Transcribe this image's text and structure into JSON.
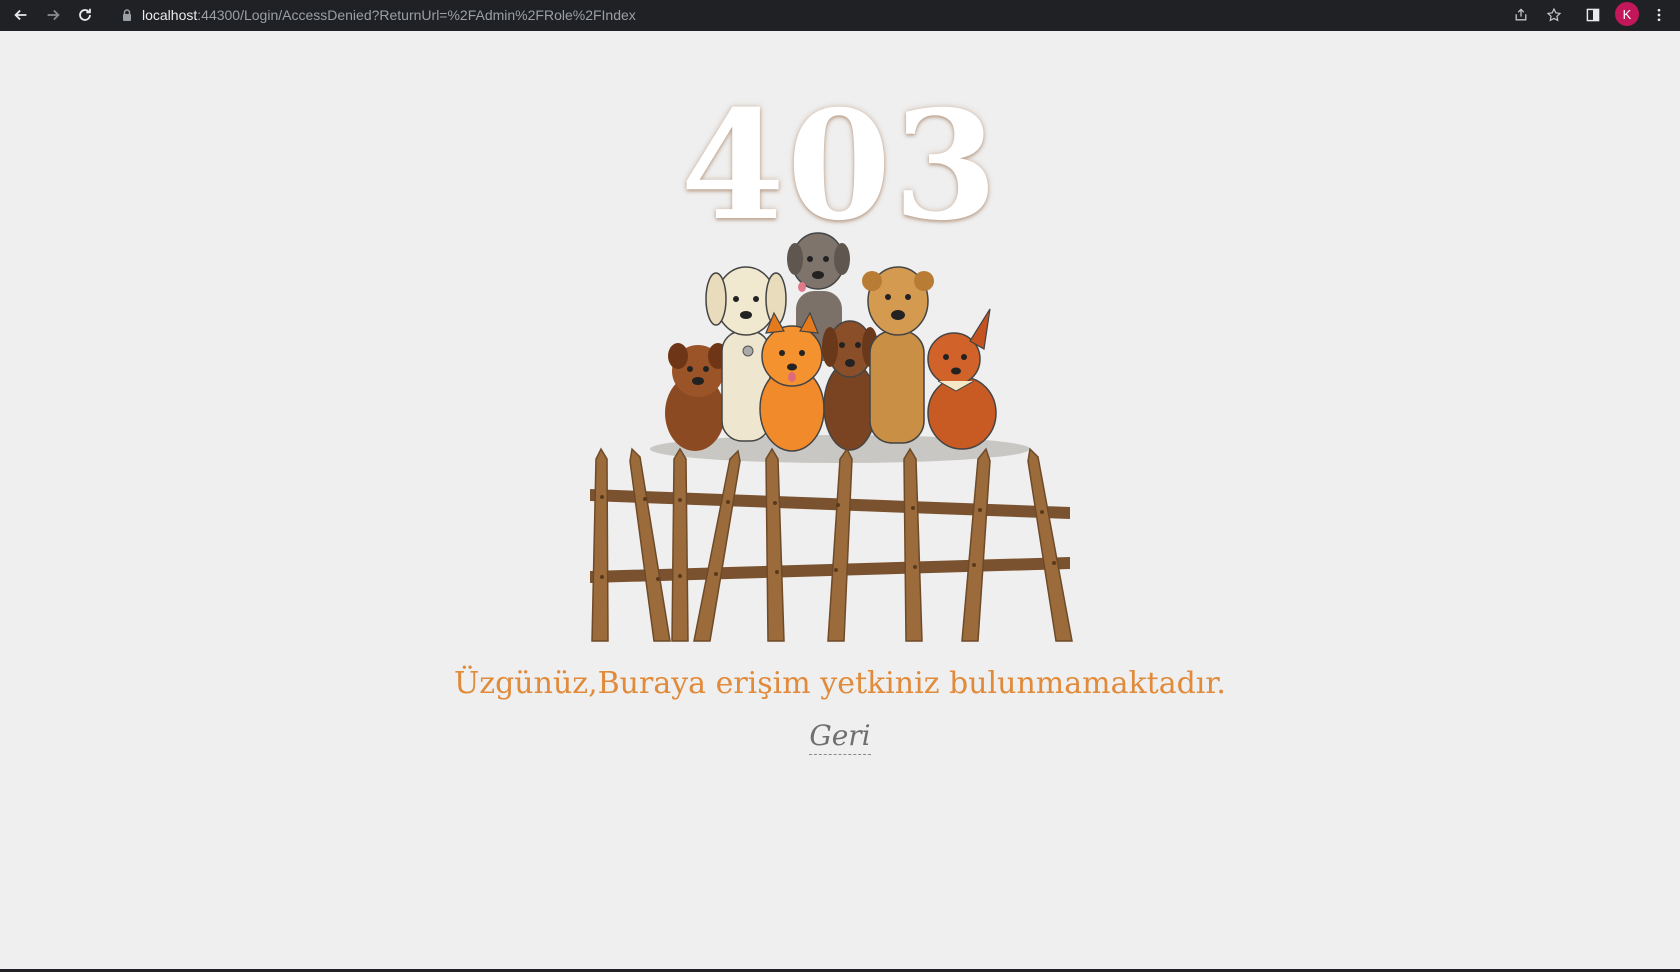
{
  "browser": {
    "url_host": "localhost",
    "url_rest": ":44300/Login/AccessDenied?ReturnUrl=%2FAdmin%2FRole%2FIndex",
    "profile_initial": "K",
    "profile_color": "#c2185b"
  },
  "page": {
    "error_code": "403",
    "message": "Üzgünüz,Buraya erişim yetkiniz bulunmamaktadır.",
    "back_label": "Geri"
  },
  "colors": {
    "message": "#e08a3a",
    "fence": "#9b6b3c",
    "background": "#efefef"
  }
}
